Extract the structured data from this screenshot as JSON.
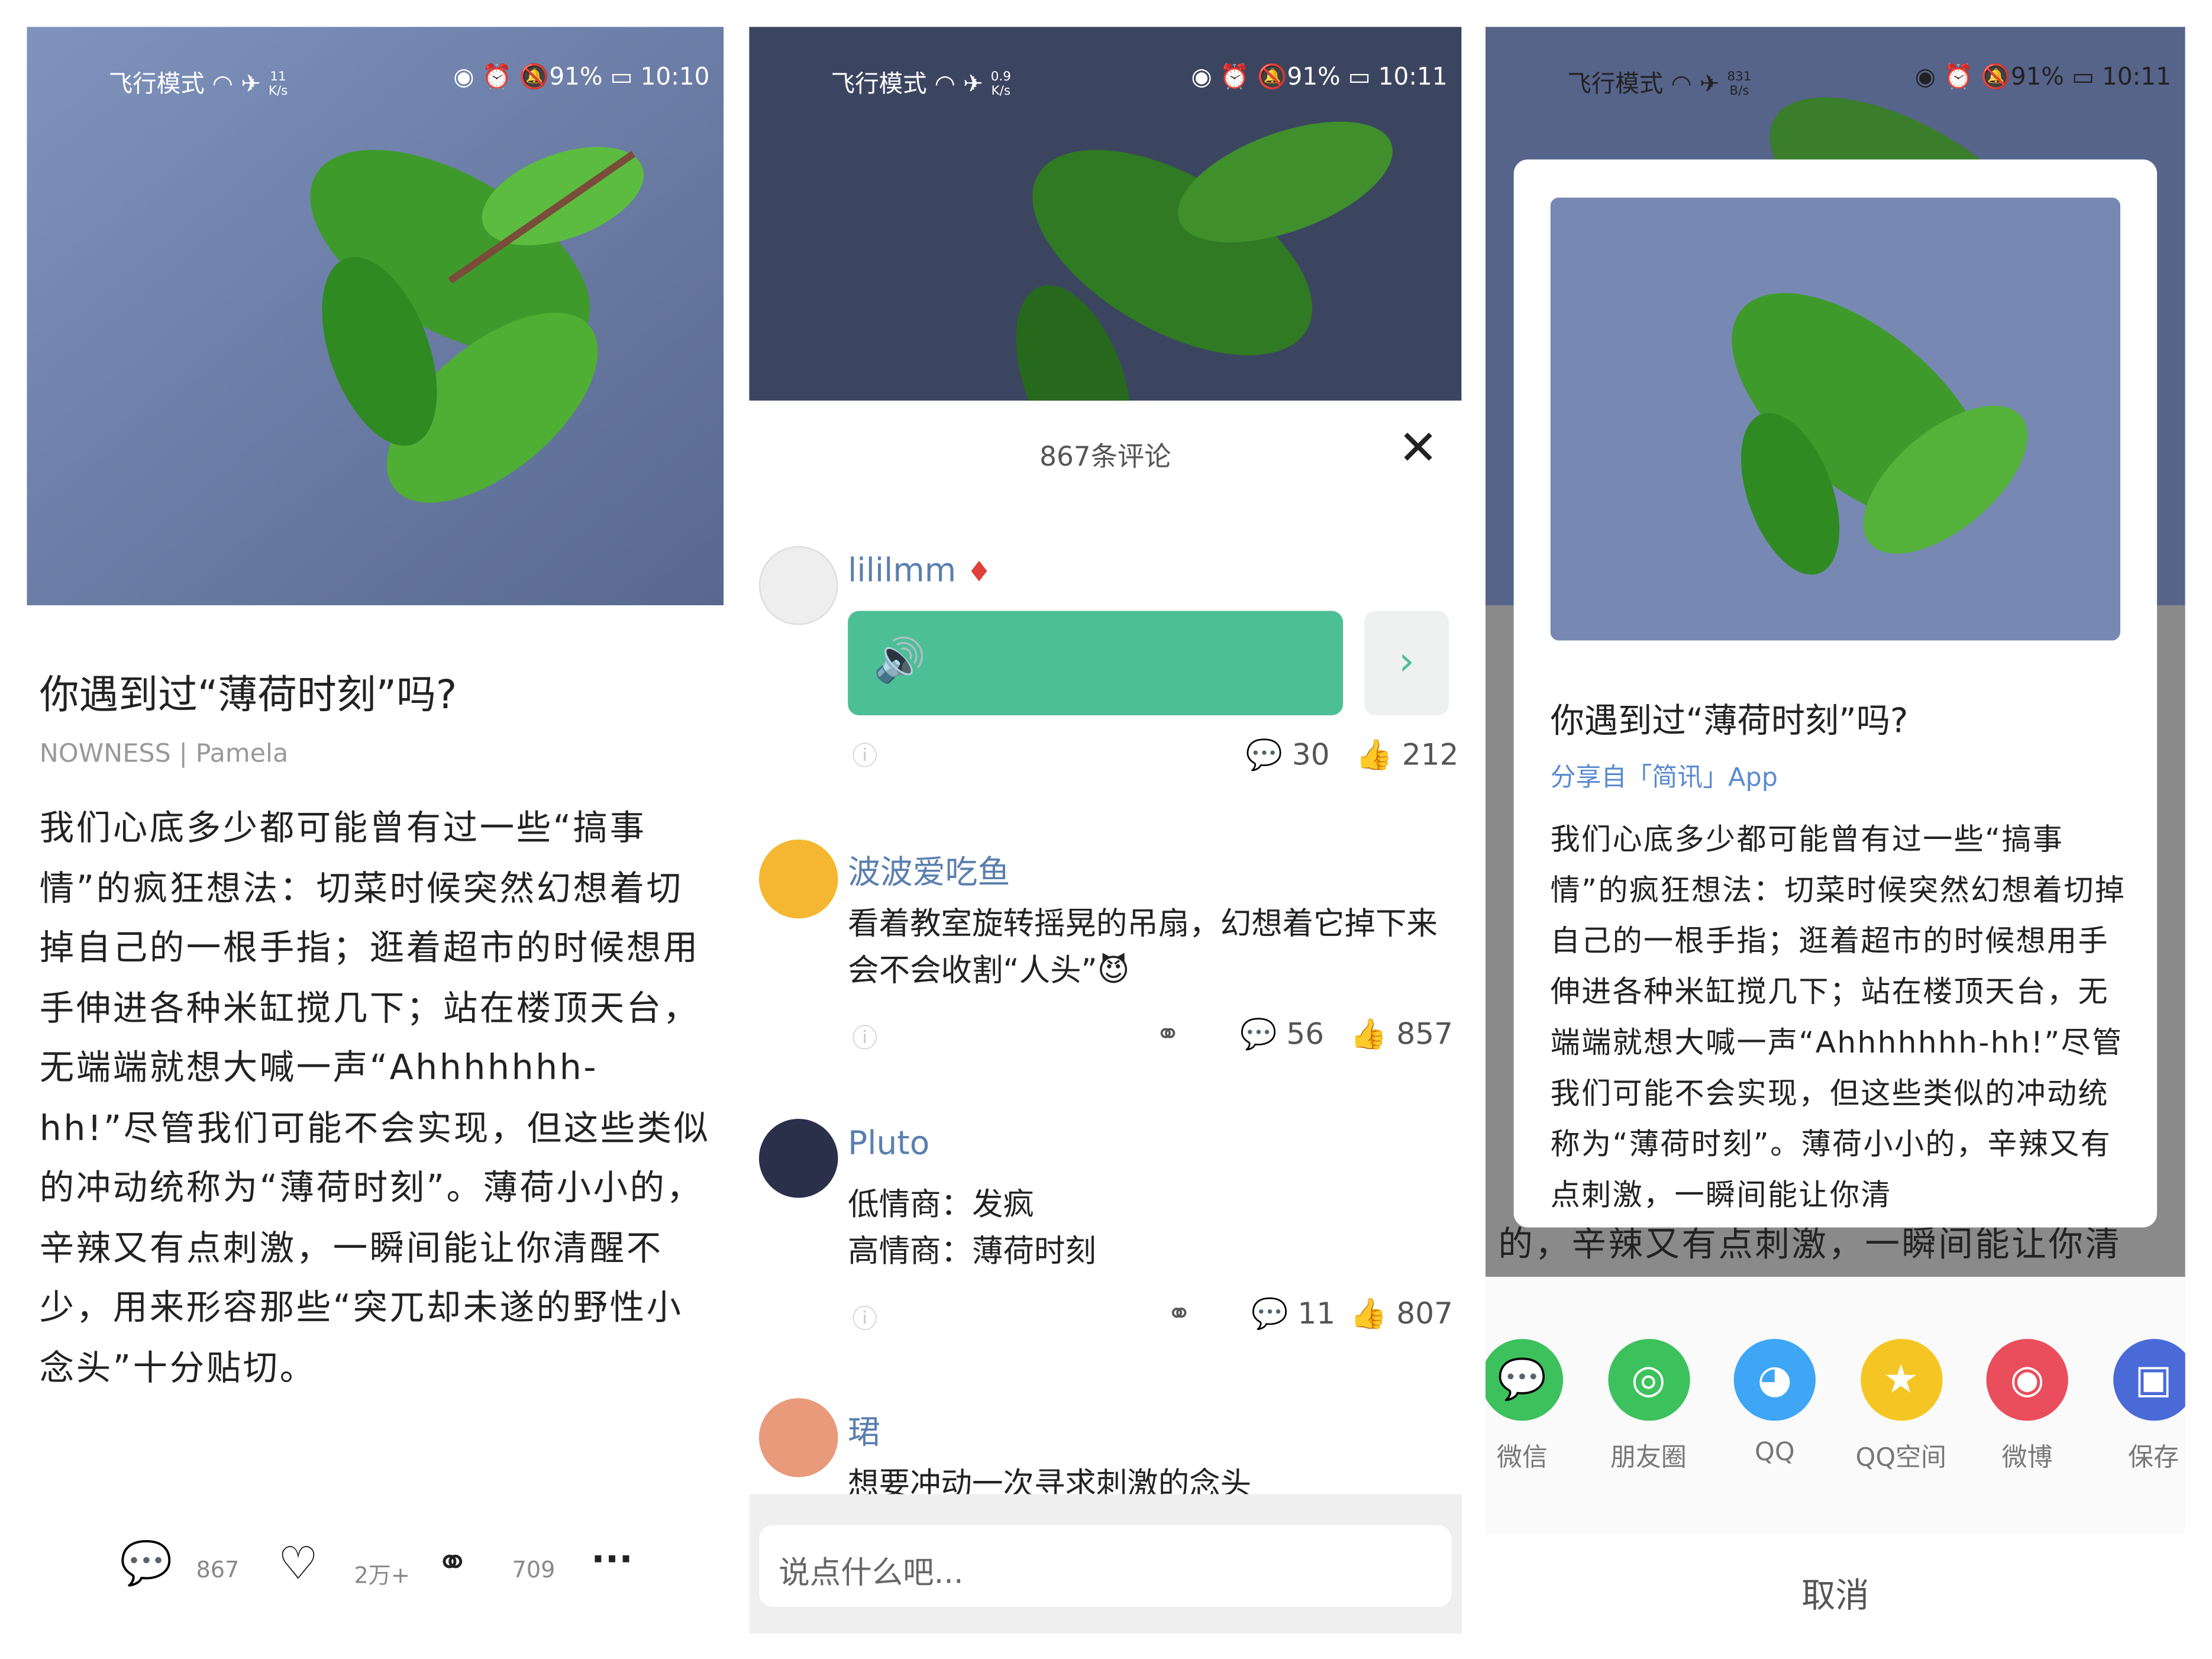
{
  "status_bars": [
    {
      "airplane_mode": "飞行模式",
      "speed_value": "11",
      "speed_unit": "K/s",
      "battery": "91%",
      "time": "10:10"
    },
    {
      "airplane_mode": "飞行模式",
      "speed_value": "0.9",
      "speed_unit": "K/s",
      "battery": "91%",
      "time": "10:11"
    },
    {
      "airplane_mode": "飞行模式",
      "speed_value": "831",
      "speed_unit": "B/s",
      "battery": "91%",
      "time": "10:11"
    }
  ],
  "article": {
    "title": "你遇到过“薄荷时刻”吗?",
    "source": "NOWNESS | Pamela",
    "body": "我们心底多少都可能曾有过一些“搞事情”的疯狂想法：切菜时候突然幻想着切掉自己的一根手指；逛着超市的时候想用手伸进各种米缸搅几下；站在楼顶天台，无端端就想大喊一声“Ahhhhhhh-hh!”尽管我们可能不会实现，但这些类似的冲动统称为“薄荷时刻”。薄荷小小的，辛辣又有点刺激，一瞬间能让你清醒不少，用来形容那些“突兀却未遂的野性小念头”十分贴切。",
    "actions": {
      "comments": "867",
      "likes": "2万+",
      "shares": "709"
    }
  },
  "comments_panel": {
    "header": "867条评论",
    "comments": [
      {
        "name": "lililmm",
        "type": "voice",
        "replies": "30",
        "likes": "212"
      },
      {
        "name": "波波爱吃鱼",
        "text": "看着教室旋转摇晃的吊扇，幻想着它掉下来会不会收割“人头”😈",
        "replies": "56",
        "likes": "857"
      },
      {
        "name": "Pluto",
        "text": "低情商：发疯\n高情商：薄荷时刻",
        "replies": "11",
        "likes": "807"
      },
      {
        "name": "珺",
        "text": "想要冲动一次寻求刺激的念头"
      }
    ],
    "input_placeholder": "说点什么吧..."
  },
  "share_sheet": {
    "card_title": "你遇到过“薄荷时刻”吗?",
    "card_source": "分享自「简讯」App",
    "card_body": "我们心底多少都可能曾有过一些“搞事情”的疯狂想法：切菜时候突然幻想着切掉自己的一根手指；逛着超市的时候想用手伸进各种米缸搅几下；站在楼顶天台，无端端就想大喊一声“Ahhhhhhh-hh!”尽管我们可能不会实现，但这些类似的冲动统称为“薄荷时刻”。薄荷小小的，辛辣又有点刺激，一瞬间能让你清",
    "background_line": "的，辛辣又有点刺激，一瞬间能让你清",
    "targets": [
      {
        "label": "微信",
        "icon": "wechat-icon",
        "color": "#3dc15c"
      },
      {
        "label": "朋友圈",
        "icon": "moments-icon",
        "color": "#3dc15c"
      },
      {
        "label": "QQ",
        "icon": "qq-icon",
        "color": "#3ea6f5"
      },
      {
        "label": "QQ空间",
        "icon": "qzone-icon",
        "color": "#f5c623"
      },
      {
        "label": "微博",
        "icon": "weibo-icon",
        "color": "#ea4d5c"
      },
      {
        "label": "保存",
        "icon": "save-image-icon",
        "color": "#4a6ad8"
      }
    ],
    "cancel": "取消"
  },
  "colors": {
    "accent_green": "#4dbf96",
    "link_blue": "#5a7fae"
  }
}
